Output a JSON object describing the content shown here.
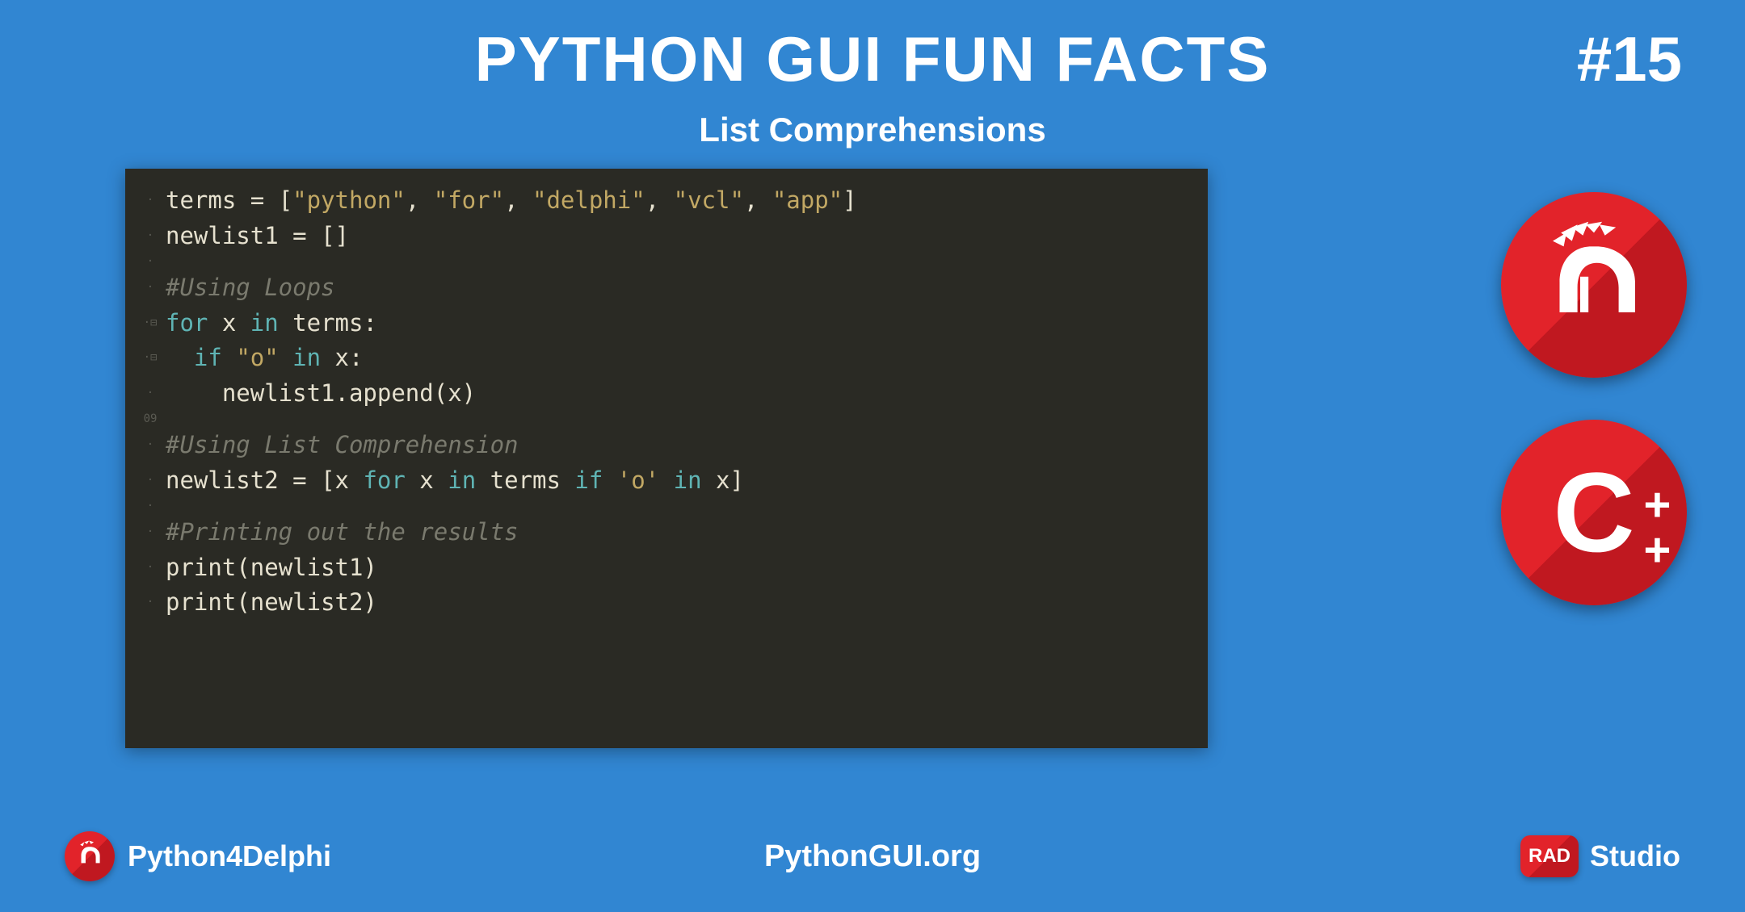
{
  "header": {
    "title": "PYTHON GUI FUN FACTS",
    "number": "#15",
    "subtitle": "List Comprehensions"
  },
  "code": {
    "line1_a": "terms ",
    "line1_b": "=",
    "line1_c": " [",
    "line1_d": "\"python\"",
    "line1_e": ", ",
    "line1_f": "\"for\"",
    "line1_g": ", ",
    "line1_h": "\"delphi\"",
    "line1_i": ", ",
    "line1_j": "\"vcl\"",
    "line1_k": ", ",
    "line1_l": "\"app\"",
    "line1_m": "]",
    "line2_a": "newlist1 ",
    "line2_b": "=",
    "line2_c": " []",
    "line4": "#Using Loops",
    "line5_a": "for",
    "line5_b": " x ",
    "line5_c": "in",
    "line5_d": " terms:",
    "line6_a": "  ",
    "line6_b": "if",
    "line6_c": " ",
    "line6_d": "\"o\"",
    "line6_e": " ",
    "line6_f": "in",
    "line6_g": " x:",
    "line7_a": "    newlist1.append(x)",
    "line9": "#Using List Comprehension",
    "line10_a": "newlist2 ",
    "line10_b": "=",
    "line10_c": " [x ",
    "line10_d": "for",
    "line10_e": " x ",
    "line10_f": "in",
    "line10_g": " terms ",
    "line10_h": "if",
    "line10_i": " ",
    "line10_j": "'o'",
    "line10_k": " ",
    "line10_l": "in",
    "line10_m": " x]",
    "line12": "#Printing out the results",
    "line13_a": "print",
    "line13_b": "(newlist1)",
    "line14_a": "print",
    "line14_b": "(newlist2)",
    "gutter_dot": "·",
    "gutter_fold1": "·⊟",
    "gutter_fold2": "·⊟",
    "gutter_09": "09"
  },
  "badges": {
    "delphi": "delphi-helmet-icon",
    "cpp_letter": "C",
    "cpp_plus": "+"
  },
  "footer": {
    "left_text": "Python4Delphi",
    "center_text": "PythonGUI.org",
    "rad_text": "RAD",
    "studio_text": "Studio"
  }
}
